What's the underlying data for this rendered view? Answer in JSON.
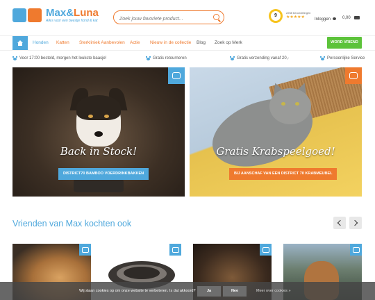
{
  "header": {
    "logo": {
      "name_part1": "Max",
      "name_amp": "&",
      "name_part2": "Luna",
      "tagline": "Alles voor een beestje hond & kat"
    },
    "search_placeholder": "Zoek jouw favoriete product...",
    "rating": {
      "score": "9",
      "reviews_label": "2258 beoordelingen",
      "stars": "★★★★★"
    },
    "login_label": "Inloggen",
    "cart_total": "0,00"
  },
  "nav": {
    "items": [
      {
        "label": "Honden",
        "color": "blue"
      },
      {
        "label": "Katten",
        "color": "orange"
      },
      {
        "label": "Sterkliniek Aanbevolen",
        "color": "orange"
      },
      {
        "label": "Actie",
        "color": "orange"
      },
      {
        "label": "Nieuw in de collectie",
        "color": "orange"
      },
      {
        "label": "Blog",
        "color": "gray"
      },
      {
        "label": "Zoek op Merk",
        "color": "gray"
      }
    ],
    "cta_label": "WORD VRIEND"
  },
  "usps": [
    "Voor 17:00 besteld, morgen het leukste baasje!",
    "Gratis retourneren",
    "Gratis verzending vanaf 20,-",
    "Persoonlijke Service"
  ],
  "banners": [
    {
      "title": "Back in Stock!",
      "button": "DISTRICT70 BAMBOO VOERDRINKBAKKEN"
    },
    {
      "title": "Gratis Krabspeelgoed!",
      "button": "BIJ AANSCHAF VAN EEN DISTRICT 70 KRABMEUBEL"
    }
  ],
  "section": {
    "title": "Vrienden van Max kochten ook"
  },
  "cookie": {
    "text": "Wij slaan cookies op om onze website te verbeteren. Is dat akkoord?",
    "yes": "Ja",
    "no": "Nee",
    "more": "Meer over cookies »"
  },
  "colors": {
    "blue": "#4fa8dc",
    "orange": "#ef7a2e",
    "green": "#5cc33a"
  }
}
